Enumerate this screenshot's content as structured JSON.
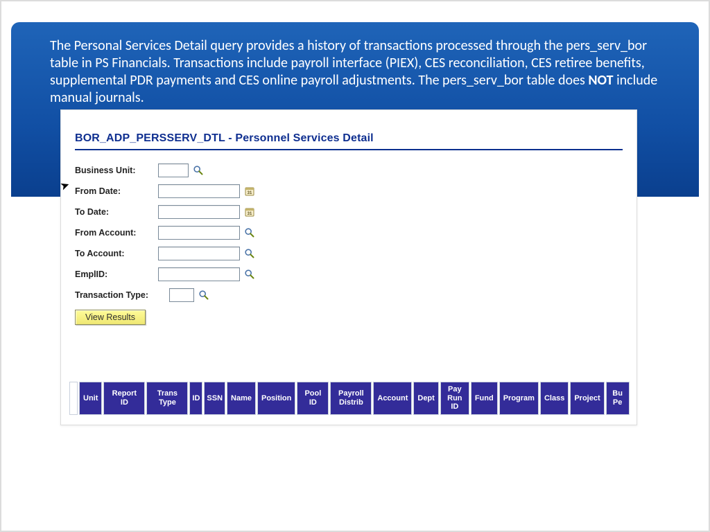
{
  "banner": {
    "text_before": "The Personal Services Detail query provides a history of transactions processed through the pers_serv_bor table in PS Financials.  Transactions include payroll interface (PIEX), CES reconciliation, CES retiree benefits, supplemental PDR payments and CES online payroll adjustments.  The pers_serv_bor table does ",
    "not_word": "NOT",
    "text_after": " include manual journals."
  },
  "panel": {
    "code": "BOR_ADP_PERSSERV_DTL",
    "title_sep": " - ",
    "title_name": "Personnel Services Detail"
  },
  "form": {
    "business_unit": {
      "label": "Business Unit:",
      "value": ""
    },
    "from_date": {
      "label": "From Date:",
      "value": ""
    },
    "to_date": {
      "label": "To Date:",
      "value": ""
    },
    "from_account": {
      "label": "From Account:",
      "value": ""
    },
    "to_account": {
      "label": "To Account:",
      "value": ""
    },
    "emplid": {
      "label": "EmplID:",
      "value": ""
    },
    "txn_type": {
      "label": "Transaction Type:",
      "value": ""
    }
  },
  "buttons": {
    "view_results": "View Results"
  },
  "icons": {
    "lookup": "lookup-icon",
    "calendar": "calendar-icon"
  },
  "table": {
    "columns": [
      "Unit",
      "Report ID",
      "Trans Type",
      "ID",
      "SSN",
      "Name",
      "Position",
      "Pool ID",
      "Payroll Distrib",
      "Account",
      "Dept",
      "Pay Run ID",
      "Fund",
      "Program",
      "Class",
      "Project",
      "Bu Pe"
    ]
  }
}
